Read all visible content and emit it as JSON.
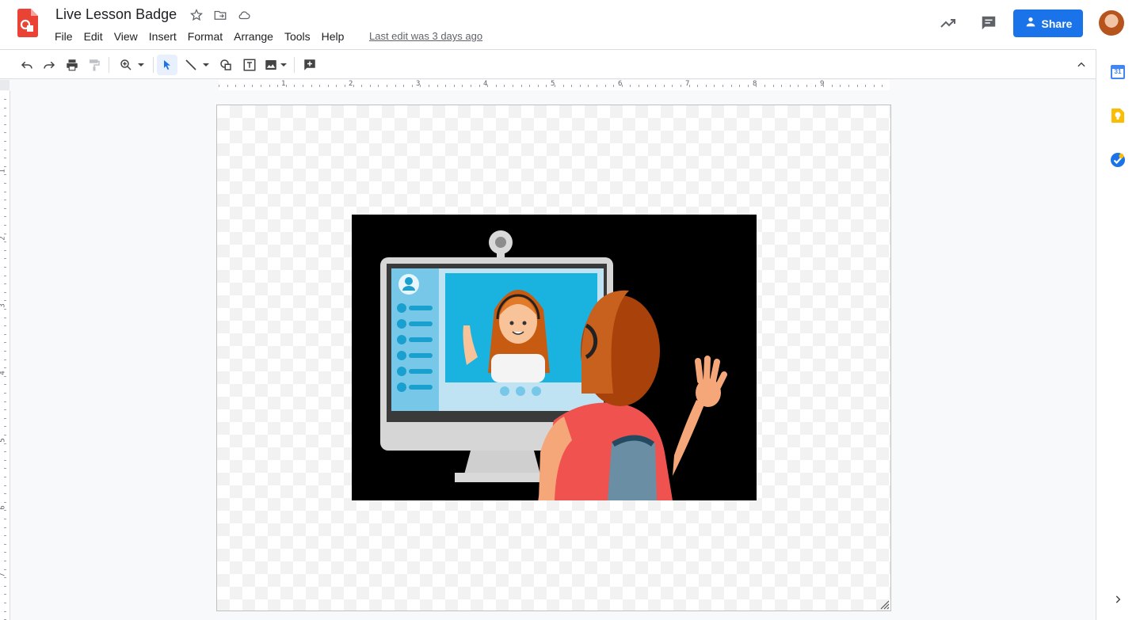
{
  "header": {
    "title": "Live Lesson Badge",
    "menus": [
      "File",
      "Edit",
      "View",
      "Insert",
      "Format",
      "Arrange",
      "Tools",
      "Help"
    ],
    "last_edit": "Last edit was 3 days ago",
    "share_label": "Share"
  },
  "icons": {
    "app_logo": "drawings-logo-icon",
    "star": "star-icon",
    "move": "move-to-folder-icon",
    "cloud": "cloud-status-icon",
    "activity": "trending-up-icon",
    "comments": "comment-icon",
    "share": "people-icon"
  },
  "toolbar": {
    "tools": [
      "undo",
      "redo",
      "print",
      "paint-format",
      "zoom",
      "select",
      "line",
      "shape",
      "text-box",
      "image",
      "new-comment",
      "collapse"
    ]
  },
  "ruler": {
    "horizontal_numbers": [
      "1",
      "2",
      "3",
      "4",
      "5",
      "6",
      "7",
      "8",
      "9"
    ],
    "vertical_numbers": [
      "1",
      "2",
      "3",
      "4",
      "5",
      "6",
      "7"
    ]
  },
  "side_panel": {
    "calendar_label": "31",
    "apps": [
      "calendar-icon",
      "keep-icon",
      "tasks-icon"
    ]
  },
  "colors": {
    "accent": "#1a73e8",
    "logo": "#ea4335",
    "keep": "#fbbc04",
    "illustration_bg": "#000000"
  }
}
